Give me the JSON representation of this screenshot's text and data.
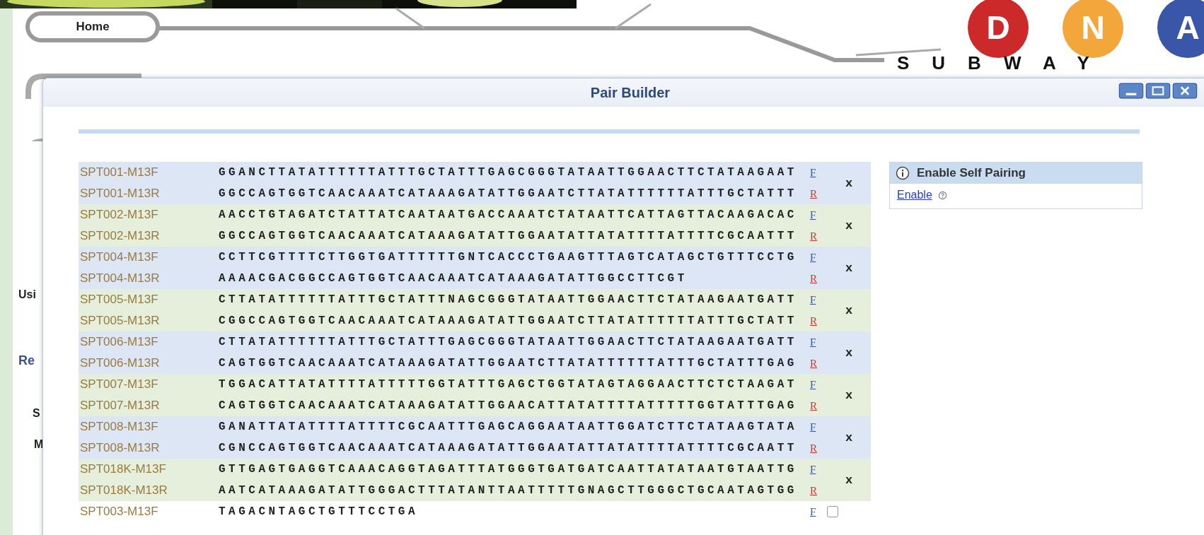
{
  "background": {
    "home_tab": "Home",
    "logo": {
      "letters": [
        {
          "text": "D",
          "color": "#cc2a2a"
        },
        {
          "text": "N",
          "color": "#f3a63a"
        },
        {
          "text": "A",
          "color": "#3a56a8"
        }
      ],
      "subtitle": "SUBWAY"
    },
    "partial_texts": [
      {
        "text": "Usi",
        "kind": "label"
      },
      {
        "text": "Re",
        "kind": "link"
      },
      {
        "text": "S",
        "kind": "label"
      },
      {
        "text": "M",
        "kind": "label"
      }
    ]
  },
  "dialog": {
    "title": "Pair Builder",
    "pairs": [
      {
        "remove": "x",
        "rows": [
          {
            "name": "SPT001-M13F",
            "sequence": "GGANCTTATATTTTTTATTTGCTATTTGAGCGGGTATAATTGGAACTTCTATAAGAAT",
            "direction": "F"
          },
          {
            "name": "SPT001-M13R",
            "sequence": "GGCCAGTGGTCAACAAATCATAAAGATATTGGAATCTTATATTTTTTATTTGCTATTT",
            "direction": "R"
          }
        ]
      },
      {
        "remove": "x",
        "rows": [
          {
            "name": "SPT002-M13F",
            "sequence": "AACCTGTAGATCTATTATCAATAATGACCAAATCTATAATTCATTAGTTACAAGACAC",
            "direction": "F"
          },
          {
            "name": "SPT002-M13R",
            "sequence": "GGCCAGTGGTCAACAAATCATAAAGATATTGGAATATTATATTTTATTTTCGCAATTT",
            "direction": "R"
          }
        ]
      },
      {
        "remove": "x",
        "rows": [
          {
            "name": "SPT004-M13F",
            "sequence": "CCTTCGTTTTCTTGGTGATTTTTTGNTCACCCTGAAGTTTAGTCATAGCTGTTTCCTG",
            "direction": "F"
          },
          {
            "name": "SPT004-M13R",
            "sequence": "AAAACGACGGCCAGTGGTCAACAAATCATAAAGATATTGGCCTTCGT",
            "direction": "R"
          }
        ]
      },
      {
        "remove": "x",
        "rows": [
          {
            "name": "SPT005-M13F",
            "sequence": "CTTATATTTTTTATTTGCTATTTNAGCGGGTATAATTGGAACTTCTATAAGAATGATT",
            "direction": "F"
          },
          {
            "name": "SPT005-M13R",
            "sequence": "CGGCCAGTGGTCAACAAATCATAAAGATATTGGAATCTTATATTTTTTATTTGCTATT",
            "direction": "R"
          }
        ]
      },
      {
        "remove": "x",
        "rows": [
          {
            "name": "SPT006-M13F",
            "sequence": "CTTATATTTTTTATTTGCTATTTGAGCGGGTATAATTGGAACTTCTATAAGAATGATT",
            "direction": "F"
          },
          {
            "name": "SPT006-M13R",
            "sequence": "CAGTGGTCAACAAATCATAAAGATATTGGAATCTTATATTTTTTATTTGCTATTTGAG",
            "direction": "R"
          }
        ]
      },
      {
        "remove": "x",
        "rows": [
          {
            "name": "SPT007-M13F",
            "sequence": "TGGACATTATATTTTATTTTTGGTATTTGAGCTGGTATAGTAGGAACTTCTCTAAGAT",
            "direction": "F"
          },
          {
            "name": "SPT007-M13R",
            "sequence": "CAGTGGTCAACAAATCATAAAGATATTGGAACATTATATTTTATTTTTGGTATTTGAG",
            "direction": "R"
          }
        ]
      },
      {
        "remove": "x",
        "rows": [
          {
            "name": "SPT008-M13F",
            "sequence": "GANATTATATTTTATTTTCGCAATTTGAGCAGGAATAATTGGATCTTCTATAAGTATA",
            "direction": "F"
          },
          {
            "name": "SPT008-M13R",
            "sequence": "CGNCCAGTGGTCAACAAATCATAAAGATATTGGAATATTATATTTTATTTTCGCAATT",
            "direction": "R"
          }
        ]
      },
      {
        "remove": "x",
        "rows": [
          {
            "name": "SPT018K-M13F",
            "sequence": "GTTGAGTGAGGTCAAACAGGTAGATTTATGGGTGATGATCAATTATATAATGTAATTG",
            "direction": "F"
          },
          {
            "name": "SPT018K-M13R",
            "sequence": "AATCATAAAGATATTGGGACTTTATANTTAATTTTTGNAGCTTGGGCTGCAATAGTGG",
            "direction": "R"
          }
        ]
      }
    ],
    "unpaired": [
      {
        "name": "SPT003-M13F",
        "sequence": "TAGACNTAGCTGTTTCCTGA",
        "direction": "F",
        "checked": false
      }
    ],
    "self_pairing": {
      "title": "Enable Self Pairing",
      "link": "Enable"
    }
  }
}
